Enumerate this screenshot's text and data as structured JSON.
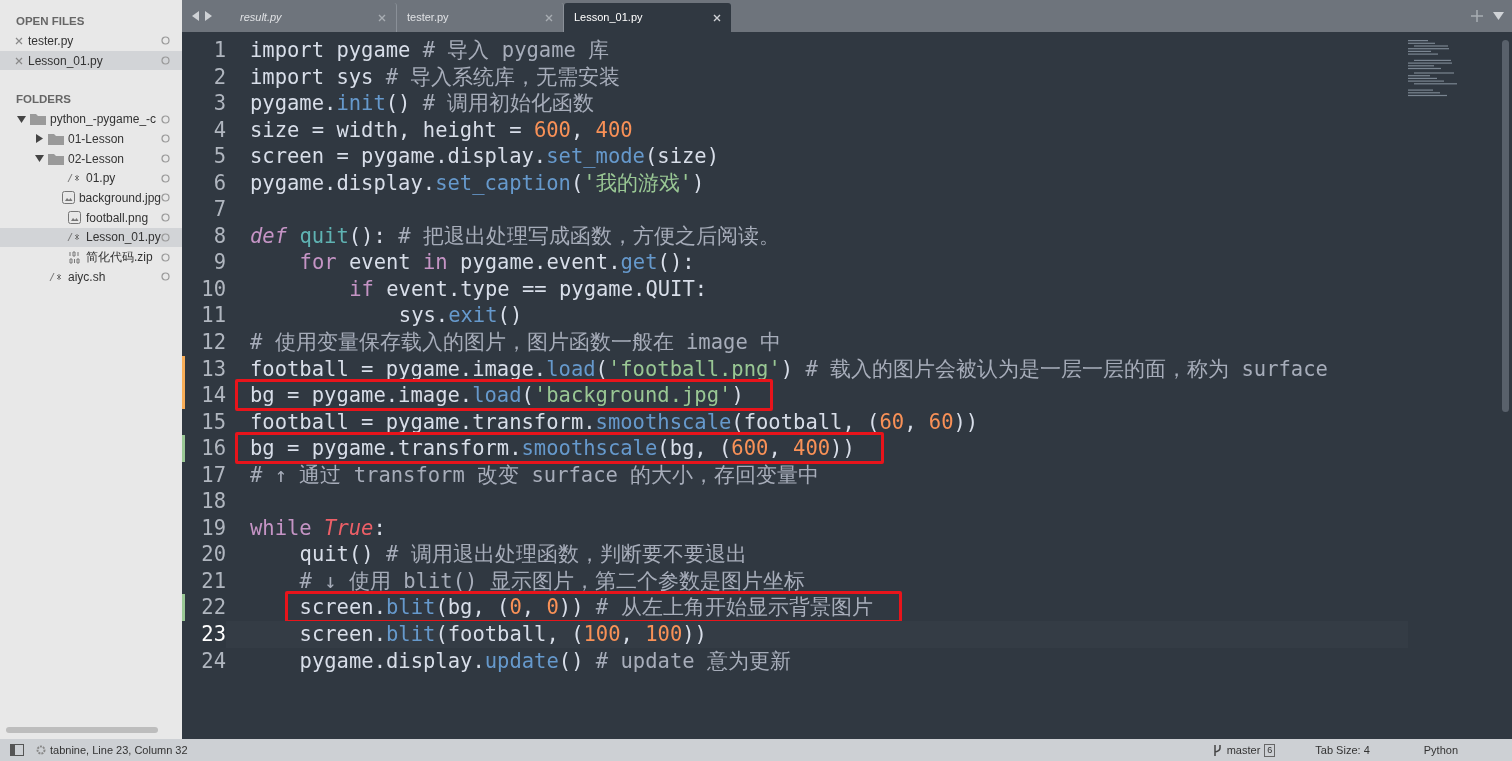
{
  "sidebar": {
    "open_files_title": "OPEN FILES",
    "open_files": [
      {
        "name": "tester.py",
        "selected": false
      },
      {
        "name": "Lesson_01.py",
        "selected": true
      }
    ],
    "folders_title": "FOLDERS",
    "folders": [
      {
        "name": "python_-pygame_-c",
        "kind": "folder",
        "expanded": true,
        "selected": false,
        "children": [
          {
            "name": "01-Lesson",
            "kind": "folder",
            "expanded": false,
            "selected": false
          },
          {
            "name": "02-Lesson",
            "kind": "folder",
            "expanded": true,
            "selected": false,
            "children": [
              {
                "name": "01.py",
                "kind": "code",
                "selected": false
              },
              {
                "name": "background.jpg",
                "kind": "image",
                "selected": false
              },
              {
                "name": "football.png",
                "kind": "image",
                "selected": false
              },
              {
                "name": "Lesson_01.py",
                "kind": "code",
                "selected": true
              },
              {
                "name": "简化代码.zip",
                "kind": "binary",
                "selected": false
              }
            ]
          },
          {
            "name": "aiyc.sh",
            "kind": "code",
            "selected": false
          }
        ]
      }
    ]
  },
  "tabs": [
    {
      "label": "result.py",
      "preview": true,
      "selected": false
    },
    {
      "label": "tester.py",
      "preview": false,
      "selected": false
    },
    {
      "label": "Lesson_01.py",
      "preview": false,
      "selected": true
    }
  ],
  "editor": {
    "lines": [
      {
        "number": "1",
        "tokens": [
          {
            "kind": "plain",
            "text": "import pygame "
          },
          {
            "kind": "comment",
            "text": "# 导入 pygame 库"
          }
        ]
      },
      {
        "number": "2",
        "tokens": [
          {
            "kind": "plain",
            "text": "import sys "
          },
          {
            "kind": "comment",
            "text": "# 导入系统库，无需安装"
          }
        ]
      },
      {
        "number": "3",
        "tokens": [
          {
            "kind": "plain",
            "text": "pygame."
          },
          {
            "kind": "func",
            "text": "init"
          },
          {
            "kind": "plain",
            "text": "() "
          },
          {
            "kind": "comment",
            "text": "# 调用初始化函数"
          }
        ]
      },
      {
        "number": "4",
        "tokens": [
          {
            "kind": "plain",
            "text": "size = width, height = "
          },
          {
            "kind": "number",
            "text": "600"
          },
          {
            "kind": "plain",
            "text": ", "
          },
          {
            "kind": "number",
            "text": "400"
          }
        ]
      },
      {
        "number": "5",
        "tokens": [
          {
            "kind": "plain",
            "text": "screen = pygame.display."
          },
          {
            "kind": "func",
            "text": "set_mode"
          },
          {
            "kind": "plain",
            "text": "(size)"
          }
        ]
      },
      {
        "number": "6",
        "tokens": [
          {
            "kind": "plain",
            "text": "pygame.display."
          },
          {
            "kind": "func",
            "text": "set_caption"
          },
          {
            "kind": "plain",
            "text": "("
          },
          {
            "kind": "string",
            "text": "'我的游戏'"
          },
          {
            "kind": "plain",
            "text": ")"
          }
        ]
      },
      {
        "number": "7"
      },
      {
        "number": "8",
        "tokens": [
          {
            "kind": "storage",
            "text": "def "
          },
          {
            "kind": "name",
            "text": "quit"
          },
          {
            "kind": "plain",
            "text": "(): "
          },
          {
            "kind": "comment",
            "text": "# 把退出处理写成函数，方便之后阅读。"
          }
        ],
        "children": [
          {
            "number": "9",
            "tokens": [
              {
                "kind": "keyword",
                "text": "for"
              },
              {
                "kind": "plain",
                "text": " event "
              },
              {
                "kind": "keyword",
                "text": "in"
              },
              {
                "kind": "plain",
                "text": " pygame.event."
              },
              {
                "kind": "func",
                "text": "get"
              },
              {
                "kind": "plain",
                "text": "():"
              }
            ],
            "children": [
              {
                "number": "10",
                "tokens": [
                  {
                    "kind": "keyword",
                    "text": "if"
                  },
                  {
                    "kind": "plain",
                    "text": " event.type == pygame.QUIT:"
                  }
                ],
                "children": [
                  {
                    "number": "11",
                    "tokens": [
                      {
                        "kind": "plain",
                        "text": "sys."
                      },
                      {
                        "kind": "func",
                        "text": "exit"
                      },
                      {
                        "kind": "plain",
                        "text": "()"
                      }
                    ]
                  }
                ]
              }
            ]
          }
        ]
      },
      {
        "number": "12",
        "tokens": [
          {
            "kind": "comment",
            "text": "# 使用变量保存载入的图片，图片函数一般在 image 中"
          }
        ]
      },
      {
        "number": "13",
        "color": "#f9ae58",
        "tokens": [
          {
            "kind": "plain",
            "text": "football = pygame.image."
          },
          {
            "kind": "func",
            "text": "load"
          },
          {
            "kind": "plain",
            "text": "("
          },
          {
            "kind": "string",
            "text": "'football.png'"
          },
          {
            "kind": "plain",
            "text": ") "
          },
          {
            "kind": "comment",
            "text": "# 载入的图片会被认为是一层一层的面，称为 surface"
          }
        ]
      },
      {
        "number": "14",
        "color": "#f9ae58",
        "boxed": true,
        "tokens": [
          {
            "kind": "plain",
            "text": "bg = pygame.image."
          },
          {
            "kind": "func",
            "text": "load"
          },
          {
            "kind": "plain",
            "text": "("
          },
          {
            "kind": "string",
            "text": "'background.jpg'"
          },
          {
            "kind": "plain",
            "text": ")"
          }
        ]
      },
      {
        "number": "15",
        "tokens": [
          {
            "kind": "plain",
            "text": "football = pygame.transform."
          },
          {
            "kind": "func",
            "text": "smoothscale"
          },
          {
            "kind": "plain",
            "text": "(football, ("
          },
          {
            "kind": "number",
            "text": "60"
          },
          {
            "kind": "plain",
            "text": ", "
          },
          {
            "kind": "number",
            "text": "60"
          },
          {
            "kind": "plain",
            "text": "))"
          }
        ]
      },
      {
        "number": "16",
        "color": "#99c794",
        "boxed": true,
        "tokens": [
          {
            "kind": "plain",
            "text": "bg = pygame.transform."
          },
          {
            "kind": "func",
            "text": "smoothscale"
          },
          {
            "kind": "plain",
            "text": "(bg, ("
          },
          {
            "kind": "number",
            "text": "600"
          },
          {
            "kind": "plain",
            "text": ", "
          },
          {
            "kind": "number",
            "text": "400"
          },
          {
            "kind": "plain",
            "text": "))"
          }
        ]
      },
      {
        "number": "17",
        "tokens": [
          {
            "kind": "comment",
            "text": "# ↑ 通过 transform 改变 surface 的大小，存回变量中"
          }
        ]
      },
      {
        "number": "18"
      },
      {
        "number": "19",
        "tokens": [
          {
            "kind": "keyword",
            "text": "while "
          },
          {
            "kind": "constant",
            "text": "True"
          },
          {
            "kind": "plain",
            "text": ":"
          }
        ],
        "children": [
          {
            "number": "20",
            "tokens": [
              {
                "kind": "plain",
                "text": "quit() "
              },
              {
                "kind": "comment",
                "text": "# 调用退出处理函数，判断要不要退出"
              }
            ]
          },
          {
            "number": "21",
            "tokens": [
              {
                "kind": "comment",
                "text": "# ↓ 使用 blit() 显示图片，第二个参数是图片坐标"
              }
            ]
          },
          {
            "number": "22",
            "color": "#99c794",
            "boxed": true,
            "tokens": [
              {
                "kind": "plain",
                "text": "screen."
              },
              {
                "kind": "func",
                "text": "blit"
              },
              {
                "kind": "plain",
                "text": "(bg, ("
              },
              {
                "kind": "number",
                "text": "0"
              },
              {
                "kind": "plain",
                "text": ", "
              },
              {
                "kind": "number",
                "text": "0"
              },
              {
                "kind": "plain",
                "text": ")) "
              },
              {
                "kind": "comment",
                "text": "# 从左上角开始显示背景图片"
              }
            ]
          },
          {
            "number": "23",
            "current": true,
            "tokens": [
              {
                "kind": "plain",
                "text": "screen."
              },
              {
                "kind": "func",
                "text": "blit"
              },
              {
                "kind": "plain",
                "text": "(football, ("
              },
              {
                "kind": "number",
                "text": "100"
              },
              {
                "kind": "plain",
                "text": ", "
              },
              {
                "kind": "number",
                "text": "100"
              },
              {
                "kind": "plain",
                "text": "))"
              }
            ]
          },
          {
            "number": "24",
            "tokens": [
              {
                "kind": "plain",
                "text": "pygame.display."
              },
              {
                "kind": "func",
                "text": "update"
              },
              {
                "kind": "plain",
                "text": "() "
              },
              {
                "kind": "comment",
                "text": "# update 意为更新"
              }
            ]
          }
        ]
      }
    ]
  },
  "status_bar": {
    "position": "tabnine, Line 23, Column 32",
    "branch": "master",
    "changes": "6",
    "tab_size": "Tab Size: 4",
    "syntax": "Python"
  }
}
